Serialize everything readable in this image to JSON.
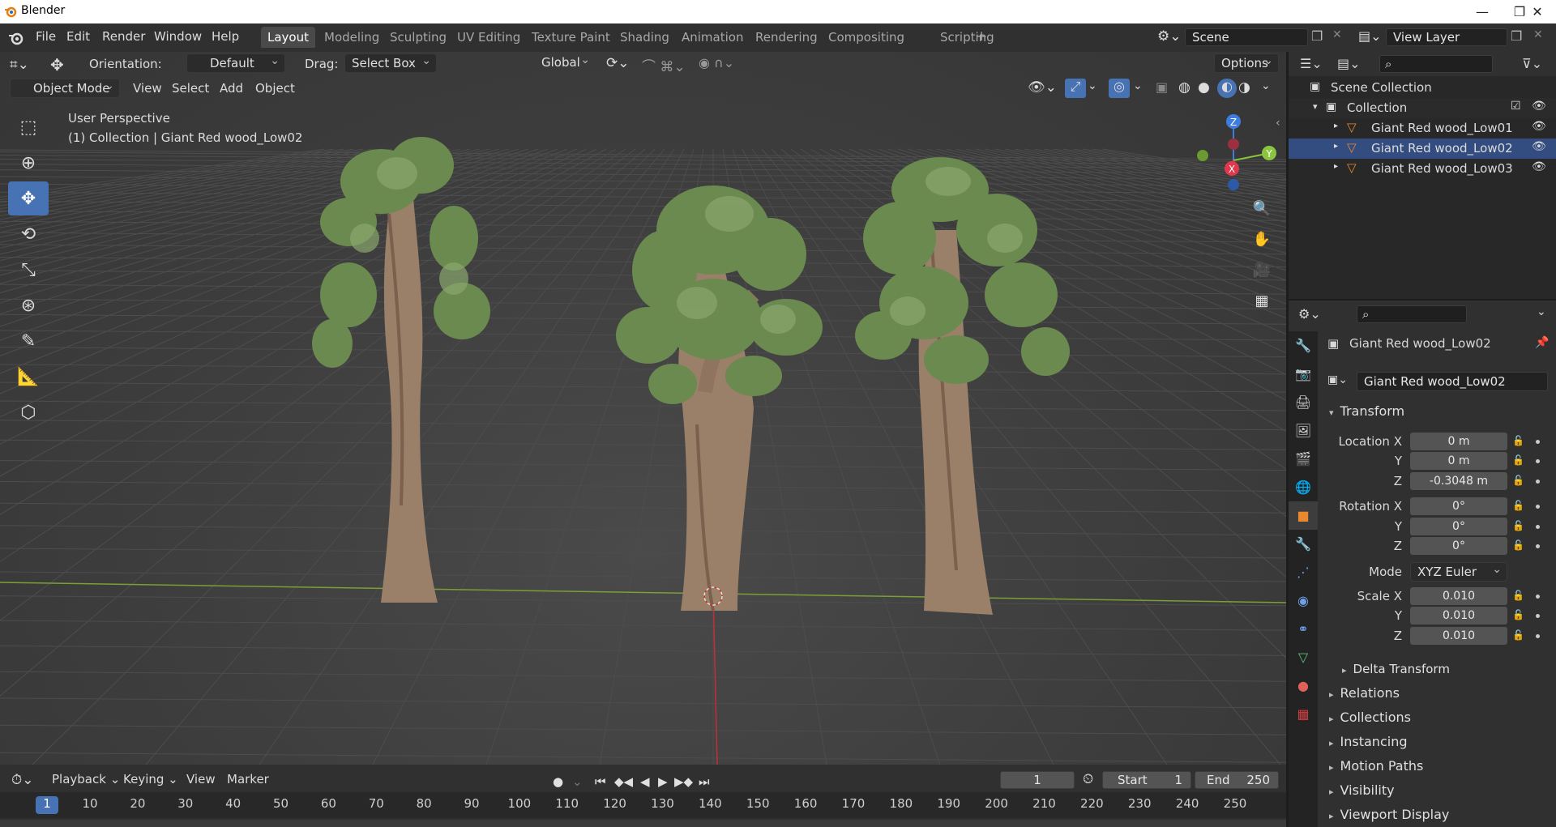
{
  "app": {
    "title": "Blender"
  },
  "menu": [
    "File",
    "Edit",
    "Render",
    "Window",
    "Help"
  ],
  "workspaces": [
    "Layout",
    "Modeling",
    "Sculpting",
    "UV Editing",
    "Texture Paint",
    "Shading",
    "Animation",
    "Rendering",
    "Compositing",
    "Scripting"
  ],
  "active_workspace": "Layout",
  "scene": {
    "name": "Scene",
    "view_layer": "View Layer"
  },
  "tool_header": {
    "orientation_label": "Orientation:",
    "orientation_value": "Default",
    "drag_label": "Drag:",
    "drag_value": "Select Box",
    "transform_orientation": "Global",
    "options": "Options"
  },
  "viewport_header": {
    "mode": "Object Mode",
    "menus": [
      "View",
      "Select",
      "Add",
      "Object"
    ]
  },
  "viewport": {
    "perspective": "User Perspective",
    "collection_info": "(1) Collection | Giant Red wood_Low02",
    "gizmo": {
      "x": "X",
      "y": "Y",
      "z": "Z"
    }
  },
  "outliner": {
    "root": "Scene Collection",
    "collection": "Collection",
    "objects": [
      "Giant Red wood_Low01",
      "Giant Red wood_Low02",
      "Giant Red wood_Low03"
    ],
    "selected": "Giant Red wood_Low02"
  },
  "properties": {
    "object_name": "Giant Red wood_Low02",
    "object_field": "Giant Red wood_Low02",
    "transform_title": "Transform",
    "location": {
      "label_x": "Location X",
      "label_y": "Y",
      "label_z": "Z",
      "x": "0 m",
      "y": "0 m",
      "z": "-0.3048 m"
    },
    "rotation": {
      "label_x": "Rotation X",
      "label_y": "Y",
      "label_z": "Z",
      "x": "0°",
      "y": "0°",
      "z": "0°"
    },
    "mode_label": "Mode",
    "mode_value": "XYZ Euler",
    "scale": {
      "label_x": "Scale X",
      "label_y": "Y",
      "label_z": "Z",
      "x": "0.010",
      "y": "0.010",
      "z": "0.010"
    },
    "delta_transform": "Delta Transform",
    "panels": [
      "Relations",
      "Collections",
      "Instancing",
      "Motion Paths",
      "Visibility",
      "Viewport Display"
    ]
  },
  "timeline": {
    "menus": [
      "Playback",
      "Keying",
      "View",
      "Marker"
    ],
    "current_frame": "1",
    "start_label": "Start",
    "start_value": "1",
    "end_label": "End",
    "end_value": "250",
    "ticks": [
      "1",
      "10",
      "20",
      "30",
      "40",
      "50",
      "60",
      "70",
      "80",
      "90",
      "100",
      "110",
      "120",
      "130",
      "140",
      "150",
      "160",
      "170",
      "180",
      "190",
      "200",
      "210",
      "220",
      "230",
      "240",
      "250"
    ]
  },
  "colors": {
    "accent_blue": "#4772b3",
    "axis_x": "#e1384d",
    "axis_y": "#8bc53f",
    "axis_z": "#3d7de0",
    "selected_row": "#334d80"
  }
}
